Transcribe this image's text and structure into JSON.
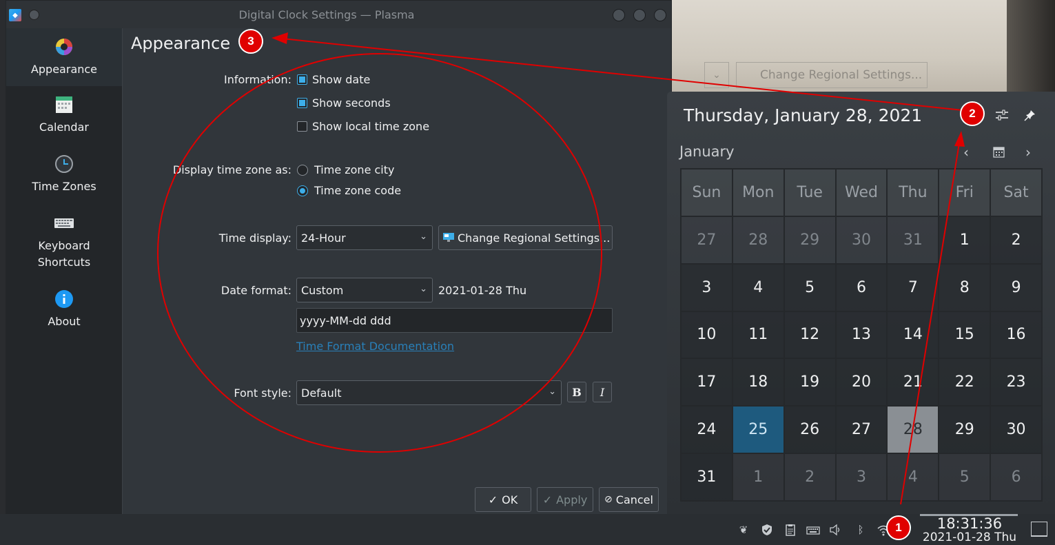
{
  "window": {
    "title": "Digital Clock Settings — Plasma"
  },
  "sidebar": {
    "items": [
      {
        "label": "Appearance",
        "icon": "color-wheel-icon"
      },
      {
        "label": "Calendar",
        "icon": "calendar-icon"
      },
      {
        "label": "Time Zones",
        "icon": "clock-icon"
      },
      {
        "label": "Keyboard\nShortcuts",
        "icon": "keyboard-icon"
      },
      {
        "label": "About",
        "icon": "info-icon"
      }
    ]
  },
  "appearance": {
    "heading": "Appearance",
    "information_label": "Information:",
    "show_date": "Show date",
    "show_seconds": "Show seconds",
    "show_local_tz": "Show local time zone",
    "tz_display_label": "Display time zone as:",
    "tz_city": "Time zone city",
    "tz_code": "Time zone code",
    "time_display_label": "Time display:",
    "time_display_value": "24-Hour",
    "change_regional": "Change Regional Settings...",
    "date_format_label": "Date format:",
    "date_format_value": "Custom",
    "date_preview": "2021-01-28 Thu",
    "date_format_pattern": "yyyy-MM-dd ddd",
    "doc_link": "Time Format Documentation",
    "font_style_label": "Font style:",
    "font_style_value": "Default",
    "bold": "B",
    "italic": "I"
  },
  "buttons": {
    "ok": "OK",
    "apply": "Apply",
    "cancel": "Cancel"
  },
  "background": {
    "ghost_button": "Change Regional Settings..."
  },
  "calendar": {
    "full_date": "Thursday, January 28, 2021",
    "month": "January",
    "weekdays": [
      "Sun",
      "Mon",
      "Tue",
      "Wed",
      "Thu",
      "Fri",
      "Sat"
    ],
    "weeks": [
      [
        "27",
        "28",
        "29",
        "30",
        "31",
        "1",
        "2"
      ],
      [
        "3",
        "4",
        "5",
        "6",
        "7",
        "8",
        "9"
      ],
      [
        "10",
        "11",
        "12",
        "13",
        "14",
        "15",
        "16"
      ],
      [
        "17",
        "18",
        "19",
        "20",
        "21",
        "22",
        "23"
      ],
      [
        "24",
        "25",
        "26",
        "27",
        "28",
        "29",
        "30"
      ],
      [
        "31",
        "1",
        "2",
        "3",
        "4",
        "5",
        "6"
      ]
    ]
  },
  "taskbar": {
    "time": "18:31:36",
    "date": "2021-01-28 Thu"
  },
  "annotations": {
    "badge1": "1",
    "badge2": "2",
    "badge3": "3"
  },
  "colors": {
    "accent": "#3daee9",
    "annotation_red": "#e00000",
    "selected_day": "#1e5a7e"
  }
}
